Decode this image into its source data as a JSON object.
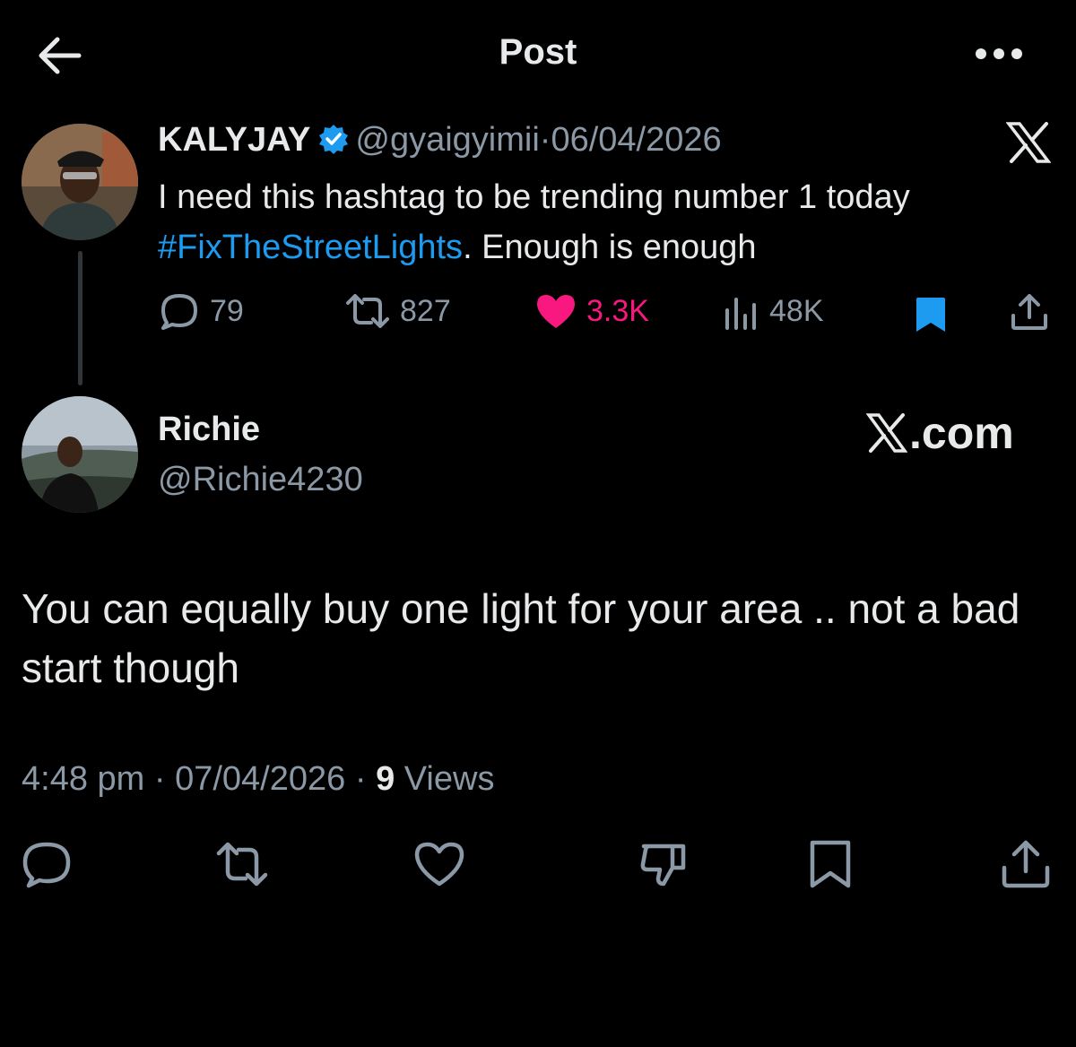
{
  "header": {
    "title": "Post",
    "back_icon": "arrow-left-icon",
    "more_icon": "more-horizontal-icon"
  },
  "parent_post": {
    "name": "KALYJAY",
    "verified_icon": "verified-badge-icon",
    "handle": "@gyaigyimii",
    "separator": "·",
    "date": "06/04/2026",
    "text_before": "I need this hashtag to be trending number 1 today ",
    "hashtag": "#FixTheStreetLights",
    "text_after": ". Enough is enough",
    "watermark_icon": "x-logo-icon",
    "stats": {
      "replies": "79",
      "reposts": "827",
      "likes": "3.3K",
      "views": "48K"
    },
    "colors": {
      "like": "#f91880",
      "bookmark": "#1d9bf0",
      "hashtag": "#1d9bf0",
      "verified": "#1d9bf0"
    }
  },
  "reply_post": {
    "name": "Richie",
    "handle": "@Richie4230",
    "watermark_text": ".com",
    "text": "You can equally buy one light for your area .. not a bad start though",
    "time": "4:48 pm",
    "date": "07/04/2026",
    "separator": "·",
    "views_count": "9",
    "views_label": "Views"
  },
  "actions": [
    "reply-icon",
    "repost-icon",
    "like-icon",
    "dislike-icon",
    "bookmark-icon",
    "share-icon"
  ]
}
